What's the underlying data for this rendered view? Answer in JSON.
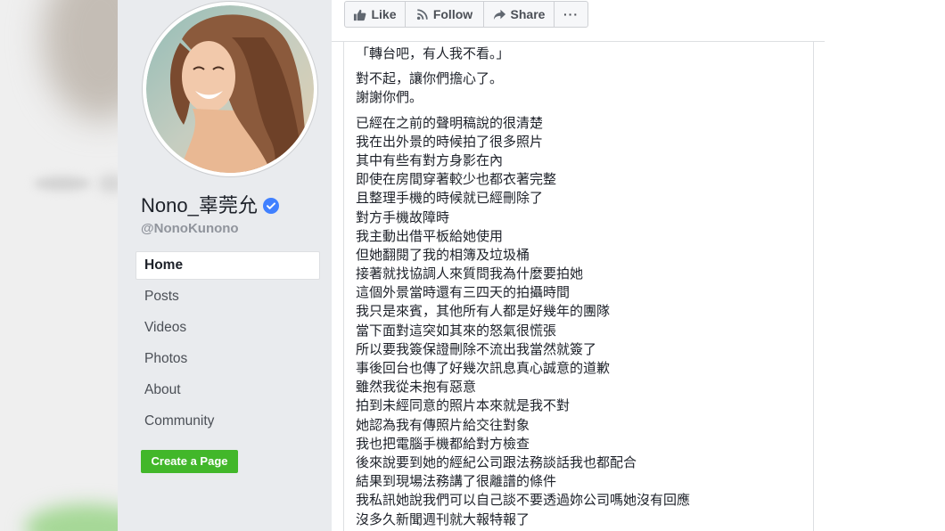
{
  "colors": {
    "sidebar_bg": "#e9ebee",
    "text_primary": "#1d2129",
    "text_secondary": "#4b4f56",
    "text_muted": "#90949c",
    "verified_blue": "#4080ff",
    "create_page_green": "#42b72a",
    "border": "#dddfe2",
    "button_bg": "#f6f7f9"
  },
  "profile": {
    "name": "Nono_辜莞允",
    "handle": "@NonoKunono",
    "verified": true,
    "verified_icon": "verified-check-icon"
  },
  "nav": {
    "items": [
      {
        "label": "Home",
        "active": true
      },
      {
        "label": "Posts",
        "active": false
      },
      {
        "label": "Videos",
        "active": false
      },
      {
        "label": "Photos",
        "active": false
      },
      {
        "label": "About",
        "active": false
      },
      {
        "label": "Community",
        "active": false
      }
    ]
  },
  "create_page": {
    "label": "Create a Page"
  },
  "actions": {
    "like": {
      "label": "Like",
      "icon": "thumbs-up-icon"
    },
    "follow": {
      "label": "Follow",
      "icon": "rss-icon"
    },
    "share": {
      "label": "Share",
      "icon": "share-arrow-icon"
    },
    "more": {
      "label": "···"
    }
  },
  "post": {
    "paragraphs": [
      {
        "lines": [
          "「轉台吧，有人我不看。」"
        ]
      },
      {
        "lines": [
          "對不起，讓你們擔心了。",
          "謝謝你們。"
        ]
      },
      {
        "lines": [
          "已經在之前的聲明稿說的很清楚",
          "我在出外景的時候拍了很多照片",
          "其中有些有對方身影在內",
          "即使在房間穿著較少也都衣著完整",
          "且整理手機的時候就已經刪除了",
          "對方手機故障時",
          "我主動出借平板給她使用",
          "但她翻閱了我的相簿及垃圾桶",
          "接著就找協調人來質問我為什麼要拍她",
          "這個外景當時還有三四天的拍攝時間",
          "我只是來賓，其他所有人都是好幾年的團隊",
          "當下面對這突如其來的怒氣很慌張",
          "所以要我簽保證刪除不流出我當然就簽了",
          "事後回台也傳了好幾次訊息真心誠意的道歉",
          "雖然我從未抱有惡意",
          "拍到未經同意的照片本來就是我不對",
          "她認為我有傳照片給交往對象",
          "我也把電腦手機都給對方檢查",
          "後來說要到她的經紀公司跟法務談話我也都配合",
          "結果到現場法務講了很離譜的條件",
          "我私訊她說我們可以自己談不要透過妳公司嗎她沒有回應",
          "沒多久新聞週刊就大報特報了"
        ]
      }
    ]
  }
}
